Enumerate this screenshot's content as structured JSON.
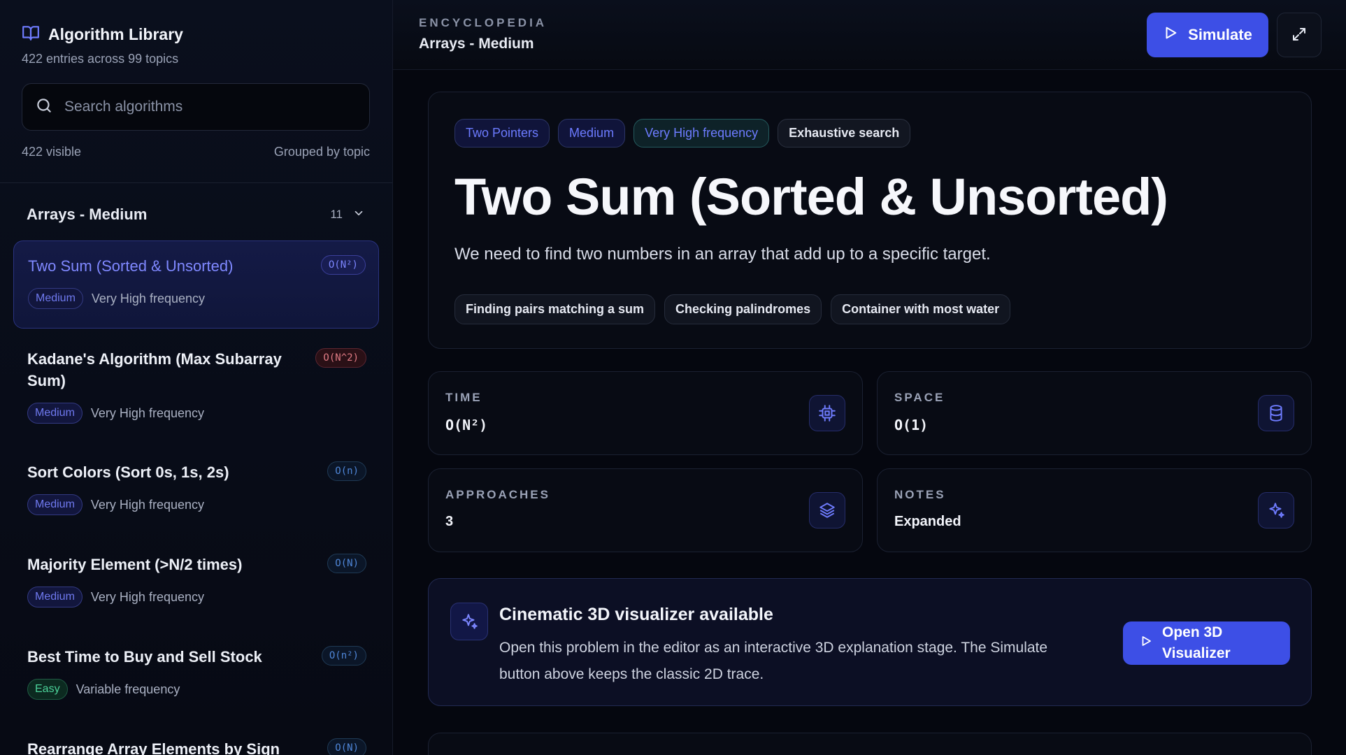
{
  "sidebar": {
    "title": "Algorithm Library",
    "subtitle": "422 entries across 99 topics",
    "search_placeholder": "Search algorithms",
    "visible_count": "422 visible",
    "grouping": "Grouped by topic",
    "group": {
      "title": "Arrays - Medium",
      "count": "11"
    },
    "items": [
      {
        "name": "Two Sum (Sorted & Unsorted)",
        "complexity": "O(N²)",
        "difficulty": "Medium",
        "frequency": "Very High frequency"
      },
      {
        "name": "Kadane's Algorithm (Max Subarray Sum)",
        "complexity": "O(N^2)",
        "difficulty": "Medium",
        "frequency": "Very High frequency"
      },
      {
        "name": "Sort Colors (Sort 0s, 1s, 2s)",
        "complexity": "O(n)",
        "difficulty": "Medium",
        "frequency": "Very High frequency"
      },
      {
        "name": "Majority Element (>N/2 times)",
        "complexity": "O(N)",
        "difficulty": "Medium",
        "frequency": "Very High frequency"
      },
      {
        "name": "Best Time to Buy and Sell Stock",
        "complexity": "O(n²)",
        "difficulty": "Easy",
        "frequency": "Variable frequency"
      },
      {
        "name": "Rearrange Array Elements by Sign",
        "complexity": "O(N)"
      }
    ]
  },
  "header": {
    "section": "ENCYCLOPEDIA",
    "breadcrumb": "Arrays - Medium",
    "simulate_label": "Simulate"
  },
  "hero": {
    "tags": [
      "Two Pointers",
      "Medium",
      "Very High frequency",
      "Exhaustive search"
    ],
    "title": "Two Sum (Sorted & Unsorted)",
    "description": "We need to find two numbers in an array that add up to a specific target.",
    "use_cases": [
      "Finding pairs matching a sum",
      "Checking palindromes",
      "Container with most water"
    ]
  },
  "stats": {
    "time": {
      "label": "TIME",
      "value": "O(N²)"
    },
    "space": {
      "label": "SPACE",
      "value": "O(1)"
    },
    "approaches": {
      "label": "APPROACHES",
      "value": "3"
    },
    "notes": {
      "label": "NOTES",
      "value": "Expanded"
    }
  },
  "visualizer": {
    "title": "Cinematic 3D visualizer available",
    "description": "Open this problem in the editor as an interactive 3D explanation stage. The Simulate button above keeps the classic 2D trace.",
    "button_label": "Open 3D Visualizer"
  },
  "colors": {
    "accent": "#3d4fe6",
    "background": "#05070f",
    "accent_text": "#7f88ff"
  }
}
